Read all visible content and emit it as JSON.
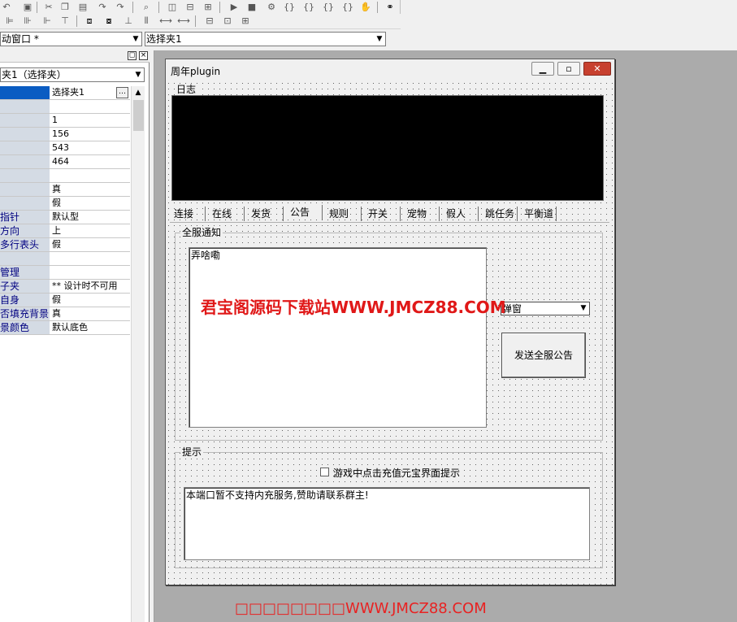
{
  "toolbar1": {
    "icons": [
      "undo-icon",
      "save-icon",
      "cut-icon",
      "copy-icon",
      "paste-icon",
      "redo-icon",
      "find-icon",
      "layout1-icon",
      "layout2-icon",
      "layout3-icon",
      "run-icon",
      "stop-icon",
      "debug1-icon",
      "debug2-icon",
      "debug3-icon",
      "debug4-icon",
      "hand-icon",
      "binoculars-icon"
    ]
  },
  "toolbar2": {
    "icons": [
      "align-left-icon",
      "align-center-icon",
      "align-right-icon",
      "align-top-icon",
      "align-middle-icon",
      "align-bottom-icon",
      "same-width-icon",
      "same-height-icon",
      "h-space-icon",
      "v-space-icon",
      "center-h-icon",
      "center-v-icon"
    ]
  },
  "window_combo": {
    "value": "动窗口 *"
  },
  "control_combo": {
    "value": "选择夹1"
  },
  "panel": {
    "object_combo": "夹1（选择夹）",
    "rows": [
      {
        "name": "",
        "value": "选择夹1"
      },
      {
        "name": "",
        "value": ""
      },
      {
        "name": "",
        "value": "1"
      },
      {
        "name": "",
        "value": "156"
      },
      {
        "name": "",
        "value": "543"
      },
      {
        "name": "",
        "value": "464"
      },
      {
        "name": "",
        "value": ""
      },
      {
        "name": "",
        "value": "真"
      },
      {
        "name": "",
        "value": "假"
      },
      {
        "name": "指针",
        "value": "默认型"
      },
      {
        "name": "方向",
        "value": "上"
      },
      {
        "name": "多行表头",
        "value": "假"
      },
      {
        "name": "",
        "value": ""
      },
      {
        "name": "管理",
        "value": ""
      },
      {
        "name": "子夹",
        "value": "** 设计时不可用"
      },
      {
        "name": "自身",
        "value": "假"
      },
      {
        "name": "否填充背景",
        "value": "真"
      },
      {
        "name": "景颜色",
        "value": "默认底色"
      }
    ]
  },
  "form": {
    "title": "周年plugin",
    "log_label": "日志",
    "tabs": [
      "连接",
      "在线",
      "发货",
      "公告",
      "规则",
      "开关",
      "宠物",
      "假人",
      "跳任务",
      "平衡道"
    ],
    "active_tab": "公告",
    "announce_group": "全服通知",
    "announce_text": "弄啥嘞",
    "type_combo": "弹窗",
    "send_button": "发送全服公告",
    "tip_group": "提示",
    "checkbox_label": "游戏中点击充值元宝界面提示",
    "tip_text": "本端口暂不支持内充服务,赞助请联系群主!"
  },
  "watermark": "君宝阁源码下载站WWW.JMCZ88.COM",
  "watermark_bottom": "□□□□□□□□WWW.JMCZ88.COM",
  "colors": {
    "log_bg": "#000000",
    "watermark": "#e01818"
  }
}
